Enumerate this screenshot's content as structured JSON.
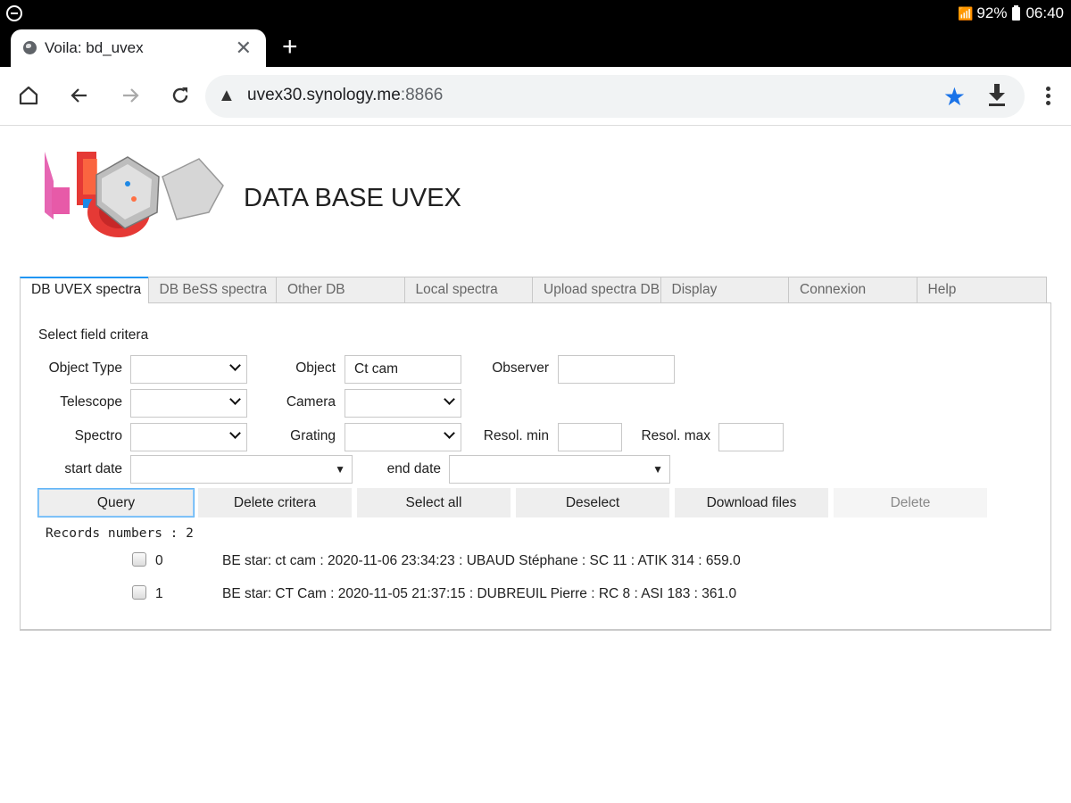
{
  "status_bar": {
    "battery": "92%",
    "time": "06:40"
  },
  "browser": {
    "tab_title": "Voila: bd_uvex",
    "url_host": "uvex30.synology.me",
    "url_port": ":8866"
  },
  "page": {
    "title": "DATA BASE UVEX",
    "tabs": [
      {
        "label": "DB UVEX spectra",
        "active": true
      },
      {
        "label": "DB BeSS spectra",
        "active": false
      },
      {
        "label": "Other DB",
        "active": false
      },
      {
        "label": "Local spectra",
        "active": false
      },
      {
        "label": "Upload spectra DB",
        "active": false
      },
      {
        "label": "Display",
        "active": false
      },
      {
        "label": "Connexion",
        "active": false
      },
      {
        "label": "Help",
        "active": false
      }
    ],
    "section_label": "Select field critera",
    "fields": {
      "object_type": {
        "label": "Object Type",
        "value": ""
      },
      "object": {
        "label": "Object",
        "value": "Ct cam"
      },
      "observer": {
        "label": "Observer",
        "value": ""
      },
      "telescope": {
        "label": "Telescope",
        "value": ""
      },
      "camera": {
        "label": "Camera",
        "value": ""
      },
      "spectro": {
        "label": "Spectro",
        "value": ""
      },
      "grating": {
        "label": "Grating",
        "value": ""
      },
      "resol_min": {
        "label": "Resol. min",
        "value": ""
      },
      "resol_max": {
        "label": "Resol. max",
        "value": ""
      },
      "start_date": {
        "label": "start date",
        "value": ""
      },
      "end_date": {
        "label": "end date",
        "value": ""
      }
    },
    "buttons": {
      "query": "Query",
      "delete_criteria": "Delete critera",
      "select_all": "Select all",
      "deselect": "Deselect",
      "download_files": "Download files",
      "delete": "Delete"
    },
    "records_label": "Records numbers : 2",
    "records": [
      {
        "index": "0",
        "checked": false,
        "text": "BE star: ct cam : 2020-11-06 23:34:23 : UBAUD Stéphane : SC 11 : ATIK 314 : 659.0"
      },
      {
        "index": "1",
        "checked": false,
        "text": "BE star: CT Cam : 2020-11-05 21:37:15 : DUBREUIL Pierre : RC 8 : ASI 183 : 361.0"
      }
    ]
  }
}
